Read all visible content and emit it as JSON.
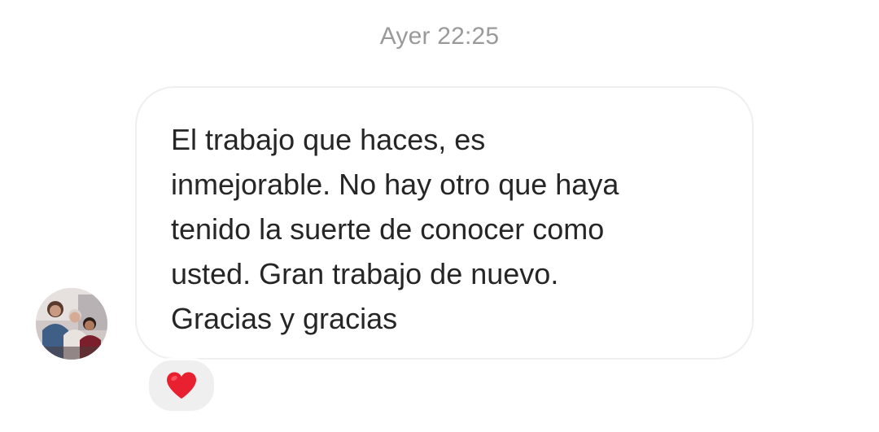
{
  "thread": {
    "timestamp": "Ayer 22:25"
  },
  "message": {
    "sender_avatar": "profile-photo",
    "text": "El trabajo que haces, es\ninmejorable. No hay otro que haya\ntenido la suerte de conocer como\nusted. Gran trabajo de nuevo.\nGracias y gracias",
    "reaction": {
      "icon": "red-heart-icon",
      "color": "#e8202f"
    }
  },
  "colors": {
    "background": "#ffffff",
    "bubble_border": "#efefef",
    "text": "#262626",
    "timestamp": "#9a9a9a",
    "reaction_pill": "#efefef"
  }
}
